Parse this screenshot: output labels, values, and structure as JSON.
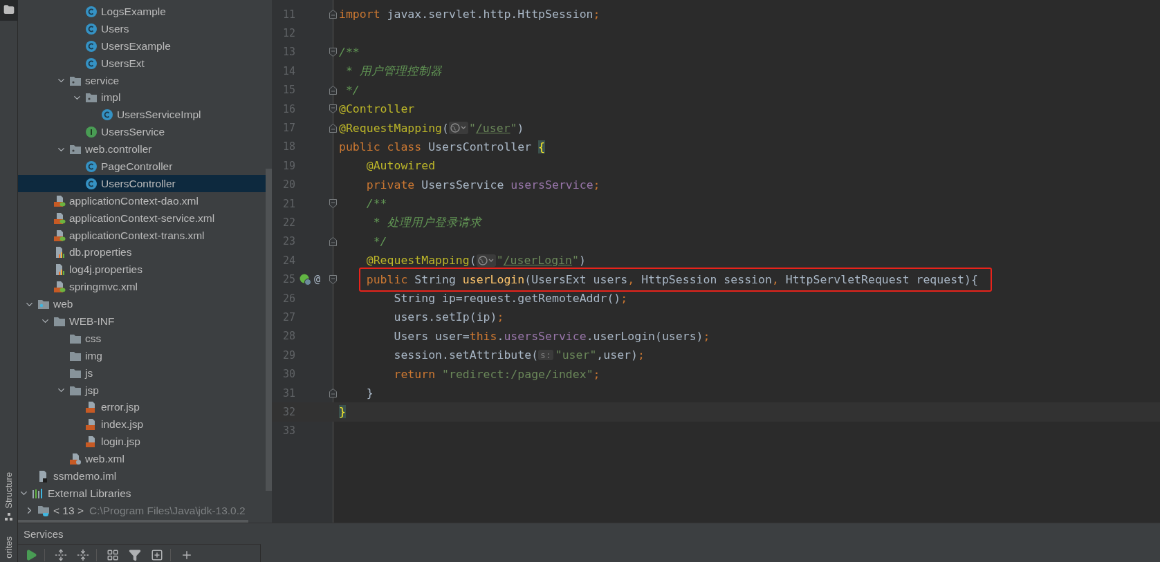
{
  "tool_stripe": [
    {
      "kind": "project",
      "selected": true
    },
    {
      "kind": "structure",
      "label": "Structure",
      "selected": false
    },
    {
      "kind": "favorites",
      "label": "orites",
      "selected": false
    }
  ],
  "project_tree": [
    {
      "children": [
        {
          "children": [
            {
              "children": [
                {
                  "children": [
                    {
                      "label": "LogsExample",
                      "kind": "class",
                      "selected": false
                    },
                    {
                      "label": "Users",
                      "kind": "class",
                      "selected": false
                    },
                    {
                      "label": "UsersExample",
                      "kind": "class",
                      "selected": false
                    },
                    {
                      "label": "UsersExt",
                      "kind": "class",
                      "selected": false
                    }
                  ]
                },
                {
                  "label": "service",
                  "kind": "package",
                  "expanded": true,
                  "selected": false,
                  "children": [
                    {
                      "label": "impl",
                      "kind": "package",
                      "expanded": true,
                      "selected": false,
                      "children": [
                        {
                          "label": "UsersServiceImpl",
                          "kind": "class",
                          "selected": false
                        }
                      ]
                    },
                    {
                      "label": "UsersService",
                      "kind": "interface",
                      "selected": false
                    }
                  ]
                },
                {
                  "label": "web.controller",
                  "kind": "package",
                  "expanded": true,
                  "selected": false,
                  "children": [
                    {
                      "label": "PageController",
                      "kind": "class",
                      "selected": false
                    },
                    {
                      "label": "UsersController",
                      "kind": "class",
                      "selected": true
                    }
                  ]
                }
              ]
            },
            {
              "label": "applicationContext-dao.xml",
              "kind": "spring-xml",
              "selected": false
            },
            {
              "label": "applicationContext-service.xml",
              "kind": "spring-xml",
              "selected": false
            },
            {
              "label": "applicationContext-trans.xml",
              "kind": "spring-xml",
              "selected": false
            },
            {
              "label": "db.properties",
              "kind": "properties",
              "selected": false
            },
            {
              "label": "log4j.properties",
              "kind": "properties",
              "selected": false
            },
            {
              "label": "springmvc.xml",
              "kind": "spring-xml",
              "selected": false
            }
          ]
        },
        {
          "label": "web",
          "kind": "web-folder",
          "expanded": true,
          "selected": false,
          "children": [
            {
              "label": "WEB-INF",
              "kind": "folder",
              "expanded": true,
              "selected": false,
              "children": [
                {
                  "label": "css",
                  "kind": "folder",
                  "selected": false
                },
                {
                  "label": "img",
                  "kind": "folder",
                  "selected": false
                },
                {
                  "label": "js",
                  "kind": "folder",
                  "selected": false
                },
                {
                  "label": "jsp",
                  "kind": "folder",
                  "expanded": true,
                  "selected": false,
                  "children": [
                    {
                      "label": "error.jsp",
                      "kind": "jsp",
                      "selected": false
                    },
                    {
                      "label": "index.jsp",
                      "kind": "jsp",
                      "selected": false
                    },
                    {
                      "label": "login.jsp",
                      "kind": "jsp",
                      "selected": false
                    }
                  ]
                },
                {
                  "label": "web.xml",
                  "kind": "web-xml",
                  "selected": false
                }
              ]
            }
          ]
        },
        {
          "label": "ssmdemo.iml",
          "kind": "iml",
          "selected": false
        }
      ]
    },
    {
      "label": "External Libraries",
      "kind": "libraries",
      "expanded": true,
      "selected": false,
      "children": [
        {
          "label": "< 13 >",
          "path": "C:\\Program Files\\Java\\jdk-13.0.2",
          "kind": "jdk",
          "expanded": false,
          "selected": false
        }
      ]
    }
  ],
  "editor": {
    "lines": [
      {
        "number": "11",
        "fold_start": false,
        "fold_end": true,
        "current": false,
        "highlighted": false,
        "tokens": [
          {
            "kind": "keyword",
            "text": "import"
          },
          {
            "kind": "plain",
            "text": " javax.servlet.http.HttpSession"
          },
          {
            "kind": "keyword",
            "text": ";"
          }
        ]
      },
      {
        "number": "12",
        "fold_start": false,
        "fold_end": false,
        "current": false,
        "highlighted": false
      },
      {
        "number": "13",
        "fold_start": true,
        "fold_end": false,
        "current": false,
        "highlighted": false,
        "tokens": [
          {
            "kind": "doc",
            "text": "/**"
          }
        ]
      },
      {
        "number": "14",
        "fold_start": false,
        "fold_end": false,
        "current": false,
        "highlighted": false,
        "tokens": [
          {
            "kind": "doc",
            "text": " * 用户管理控制器"
          }
        ]
      },
      {
        "number": "15",
        "fold_start": false,
        "fold_end": true,
        "current": false,
        "highlighted": false,
        "tokens": [
          {
            "kind": "doc",
            "text": " */"
          }
        ]
      },
      {
        "number": "16",
        "fold_start": true,
        "fold_end": false,
        "current": false,
        "highlighted": false,
        "tokens": [
          {
            "kind": "annotation",
            "text": "@Controller"
          }
        ]
      },
      {
        "number": "17",
        "fold_start": false,
        "fold_end": true,
        "current": false,
        "highlighted": false,
        "tokens": [
          {
            "kind": "annotation",
            "text": "@RequestMapping"
          },
          {
            "kind": "plain",
            "text": "("
          },
          {
            "kind": "url-inlay"
          },
          {
            "kind": "string",
            "text": "\""
          },
          {
            "kind": "link",
            "text": "/user"
          },
          {
            "kind": "string",
            "text": "\""
          },
          {
            "kind": "plain",
            "text": ")"
          }
        ]
      },
      {
        "number": "18",
        "fold_start": false,
        "fold_end": false,
        "current": false,
        "highlighted": false,
        "tokens": [
          {
            "kind": "keyword",
            "text": "public class "
          },
          {
            "kind": "plain",
            "text": "UsersController "
          },
          {
            "kind": "brace",
            "text": "{"
          }
        ],
        "children": [
          {
            "number": "19",
            "fold_start": false,
            "fold_end": false,
            "current": false,
            "highlighted": false,
            "tokens": [
              {
                "kind": "annotation",
                "text": "@Autowired"
              }
            ]
          },
          {
            "number": "20",
            "fold_start": false,
            "fold_end": false,
            "current": false,
            "highlighted": false,
            "tokens": [
              {
                "kind": "keyword",
                "text": "private "
              },
              {
                "kind": "plain",
                "text": "UsersService "
              },
              {
                "kind": "field",
                "text": "usersService"
              },
              {
                "kind": "keyword",
                "text": ";"
              }
            ]
          },
          {
            "number": "21",
            "fold_start": true,
            "fold_end": false,
            "current": false,
            "highlighted": false,
            "tokens": [
              {
                "kind": "doc",
                "text": "/**"
              }
            ]
          },
          {
            "number": "22",
            "fold_start": false,
            "fold_end": false,
            "current": false,
            "highlighted": false,
            "tokens": [
              {
                "kind": "doc",
                "text": " * 处理用户登录请求"
              }
            ]
          },
          {
            "number": "23",
            "fold_start": false,
            "fold_end": true,
            "current": false,
            "highlighted": false,
            "tokens": [
              {
                "kind": "doc",
                "text": " */"
              }
            ]
          },
          {
            "number": "24",
            "fold_start": false,
            "fold_end": false,
            "current": false,
            "highlighted": false,
            "tokens": [
              {
                "kind": "annotation",
                "text": "@RequestMapping"
              },
              {
                "kind": "plain",
                "text": "("
              },
              {
                "kind": "url-inlay"
              },
              {
                "kind": "string",
                "text": "\""
              },
              {
                "kind": "link",
                "text": "/userLogin"
              },
              {
                "kind": "string",
                "text": "\""
              },
              {
                "kind": "plain",
                "text": ")"
              }
            ]
          },
          {
            "number": "25",
            "fold_start": true,
            "fold_end": false,
            "current": false,
            "gutter_mark": "@",
            "highlighted": true,
            "tokens": [
              {
                "kind": "keyword",
                "text": "public "
              },
              {
                "kind": "plain",
                "text": "String "
              },
              {
                "kind": "method",
                "text": "userLogin"
              },
              {
                "kind": "plain",
                "text": "(UsersExt users"
              },
              {
                "kind": "keyword",
                "text": ", "
              },
              {
                "kind": "plain",
                "text": "HttpSession session"
              },
              {
                "kind": "keyword",
                "text": ", "
              },
              {
                "kind": "plain",
                "text": "HttpServletRequest request){"
              }
            ],
            "children": [
              {
                "number": "26",
                "fold_start": false,
                "fold_end": false,
                "current": false,
                "highlighted": false,
                "tokens": [
                  {
                    "kind": "plain",
                    "text": "String ip=request.getRemoteAddr()"
                  },
                  {
                    "kind": "keyword",
                    "text": ";"
                  }
                ]
              },
              {
                "number": "27",
                "fold_start": false,
                "fold_end": false,
                "current": false,
                "highlighted": false,
                "tokens": [
                  {
                    "kind": "plain",
                    "text": "users.setIp(ip)"
                  },
                  {
                    "kind": "keyword",
                    "text": ";"
                  }
                ]
              },
              {
                "number": "28",
                "fold_start": false,
                "fold_end": false,
                "current": false,
                "highlighted": false,
                "tokens": [
                  {
                    "kind": "plain",
                    "text": "Users user="
                  },
                  {
                    "kind": "keyword",
                    "text": "this"
                  },
                  {
                    "kind": "plain",
                    "text": "."
                  },
                  {
                    "kind": "field",
                    "text": "usersService"
                  },
                  {
                    "kind": "plain",
                    "text": ".userLogin(users)"
                  },
                  {
                    "kind": "keyword",
                    "text": ";"
                  }
                ]
              },
              {
                "number": "29",
                "fold_start": false,
                "fold_end": false,
                "current": false,
                "highlighted": false,
                "tokens": [
                  {
                    "kind": "plain",
                    "text": "session.setAttribute("
                  },
                  {
                    "kind": "hint",
                    "text": "s:"
                  },
                  {
                    "kind": "string",
                    "text": "\"user\""
                  },
                  {
                    "kind": "plain",
                    "text": ",user)"
                  },
                  {
                    "kind": "keyword",
                    "text": ";"
                  }
                ]
              },
              {
                "number": "30",
                "fold_start": false,
                "fold_end": false,
                "current": false,
                "highlighted": false,
                "tokens": [
                  {
                    "kind": "keyword",
                    "text": "return "
                  },
                  {
                    "kind": "string",
                    "text": "\"redirect:/page/index\""
                  },
                  {
                    "kind": "keyword",
                    "text": ";"
                  }
                ]
              }
            ]
          },
          {
            "number": "31",
            "fold_start": false,
            "fold_end": true,
            "current": false,
            "highlighted": false,
            "tokens": [
              {
                "kind": "plain",
                "text": "}"
              }
            ]
          }
        ]
      },
      {
        "number": "32",
        "fold_start": false,
        "fold_end": false,
        "current": true,
        "highlighted": false,
        "tokens": [
          {
            "kind": "brace",
            "text": "}"
          }
        ]
      },
      {
        "number": "33",
        "fold_start": false,
        "fold_end": false,
        "current": false,
        "highlighted": false
      }
    ]
  },
  "services": {
    "title": "Services",
    "tools": [
      {
        "kind": "run"
      },
      {
        "kind": "expand"
      },
      {
        "kind": "collapse"
      },
      {
        "kind": "group"
      },
      {
        "kind": "filter"
      },
      {
        "kind": "add-frame"
      },
      {
        "kind": "add"
      }
    ]
  }
}
